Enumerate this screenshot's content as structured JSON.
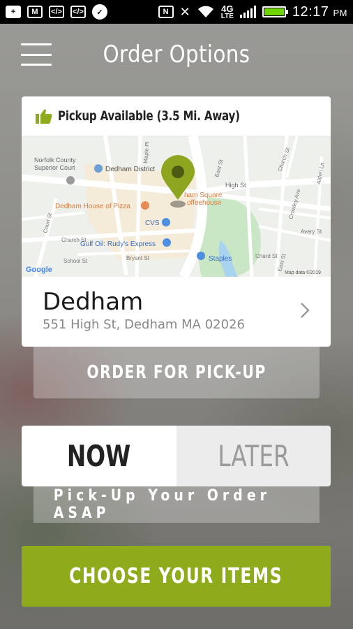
{
  "status_bar": {
    "time": "12:17",
    "ampm": "PM",
    "network": "4G",
    "network_sub": "LTE",
    "icons": [
      "add-icon",
      "gmail-icon",
      "code-icon",
      "code-icon",
      "messenger-icon",
      "nfc-icon",
      "mute-icon",
      "wifi-icon",
      "signal-icon",
      "battery-icon"
    ]
  },
  "header": {
    "title": "Order Options"
  },
  "location_card": {
    "pickup_text": "Pickup Available (3.5 Mi. Away)",
    "store_name": "Dedham",
    "store_address": "551 High St, Dedham MA 02026",
    "map": {
      "labels": {
        "court": "Norfolk County",
        "court2": "Superior Court",
        "district": "Dedham District",
        "coffee": "ham Square",
        "coffee2": "offeehouse",
        "pizza": "Dedham House of Pizza",
        "cvs": "CVS",
        "gulf": "Gulf Oil: Rudy's Express",
        "staples": "Staples",
        "high_st": "High St",
        "east_st": "East St",
        "church_st": "Church St",
        "court_st": "Court St",
        "church_st2": "Church St",
        "school_st": "School St",
        "bryant_st": "Bryant St",
        "crowley_ave": "Crowley Ave",
        "avery_st": "Avery St",
        "eastern_st": "East St",
        "alden_ln": "Alden Ln",
        "maple_pl": "Maple Pl",
        "chard_st": "Chard St",
        "google": "Google",
        "map_data": "Map data ©2019"
      }
    }
  },
  "buttons": {
    "order_for_pickup": "ORDER FOR PICK-UP",
    "now": "NOW",
    "later": "LATER",
    "asap_text": "Pick-Up Your Order ASAP",
    "choose_items": "CHOOSE YOUR ITEMS"
  },
  "colors": {
    "accent": "#8eab1b",
    "pin": "#8ea51f",
    "status_bar": "#000000"
  }
}
